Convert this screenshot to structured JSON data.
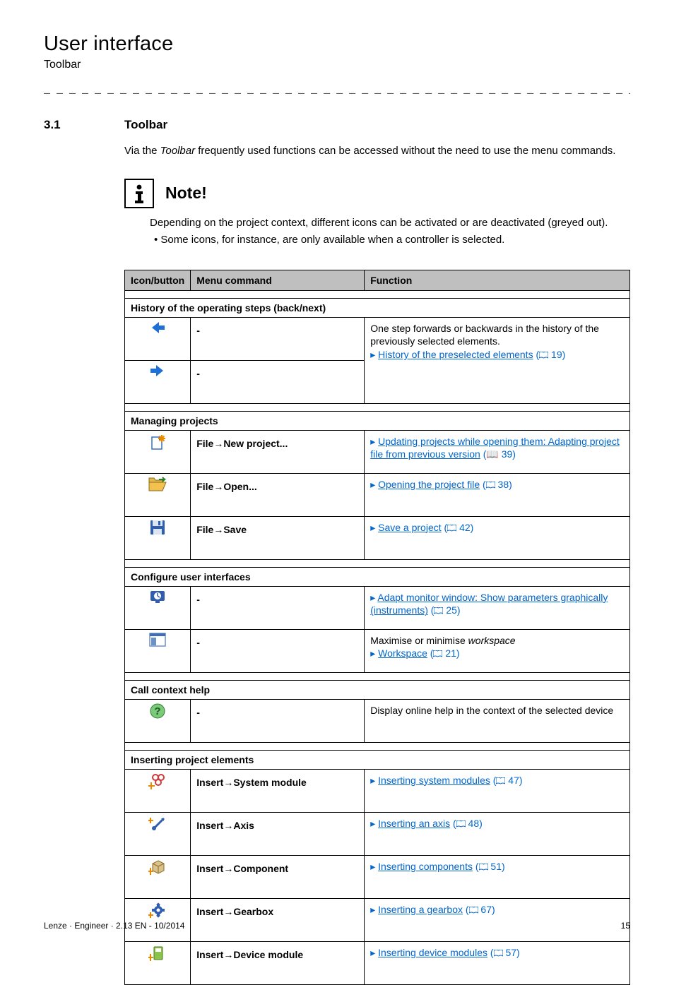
{
  "header": {
    "title": "User interface",
    "subtitle": "Toolbar"
  },
  "section": {
    "number": "3.1",
    "heading": "Toolbar",
    "intro_a": "Via the ",
    "intro_em": "Toolbar",
    "intro_b": " frequently used functions can be accessed without the need to use the menu commands."
  },
  "note": {
    "title": "Note!",
    "body": "Depending on the project context, different icons can be activated or are deactivated (greyed out).",
    "bullet": "Some icons, for instance, are only available when a controller is selected."
  },
  "table": {
    "columns": {
      "icon": "Icon/button",
      "cmd": "Menu command",
      "fn": "Function"
    },
    "groups": {
      "history": "History of the operating steps (back/next)",
      "projects": "Managing projects",
      "interfaces": "Configure user interfaces",
      "help": "Call context help",
      "inserting": "Inserting project elements"
    },
    "cells": {
      "dash": "-",
      "fn_history_line1": "One step forwards or backwards in the history of the previously selected elements.",
      "fn_history_link": "History of the preselected elements",
      "fn_history_ref": " 19)",
      "cmd_new": "File→New project...",
      "fn_new_link": "Updating projects while opening them: Adapting project file from previous version",
      "fn_new_ref": "  (📖 39)",
      "cmd_open": "File→Open...",
      "fn_open_link": "Opening the project file",
      "fn_open_ref": " 38)",
      "cmd_save": "File→Save",
      "fn_save_link": "Save a project",
      "fn_save_ref": " 42)",
      "fn_monitor_link": "Adapt monitor window: Show parameters graphically (instruments)",
      "fn_monitor_ref": " 25)",
      "fn_workspace_line1a": "Maximise or minimise ",
      "fn_workspace_line1em": "workspace",
      "fn_workspace_link": "Workspace",
      "fn_workspace_ref": " 21)",
      "fn_help": "Display online help in the context of the selected device",
      "cmd_sysmod": "Insert→System module",
      "fn_sysmod_link": "Inserting system modules",
      "fn_sysmod_ref": " 47)",
      "cmd_axis": "Insert→Axis",
      "fn_axis_link": "Inserting an axis",
      "fn_axis_ref": " 48)",
      "cmd_comp": "Insert→Component",
      "fn_comp_link": "Inserting components",
      "fn_comp_ref": " 51)",
      "cmd_gear": "Insert→Gearbox",
      "fn_gear_link": "Inserting a gearbox",
      "fn_gear_ref": " 67)",
      "cmd_devmod": "Insert→Device module",
      "fn_devmod_link": "Inserting device modules",
      "fn_devmod_ref": " 57)"
    }
  },
  "footer": {
    "left": "Lenze · Engineer · 2.13 EN - 10/2014",
    "right": "15"
  },
  "icons": {
    "back_arrow": "back-arrow-icon",
    "forward_arrow": "forward-arrow-icon",
    "new_project": "new-project-icon",
    "open": "open-icon",
    "save": "save-icon",
    "monitor": "monitor-icon",
    "workspace": "workspace-icon",
    "help": "help-icon",
    "system_module": "system-module-icon",
    "axis": "axis-icon",
    "component": "component-icon",
    "gearbox": "gearbox-icon",
    "device_module": "device-module-icon"
  }
}
